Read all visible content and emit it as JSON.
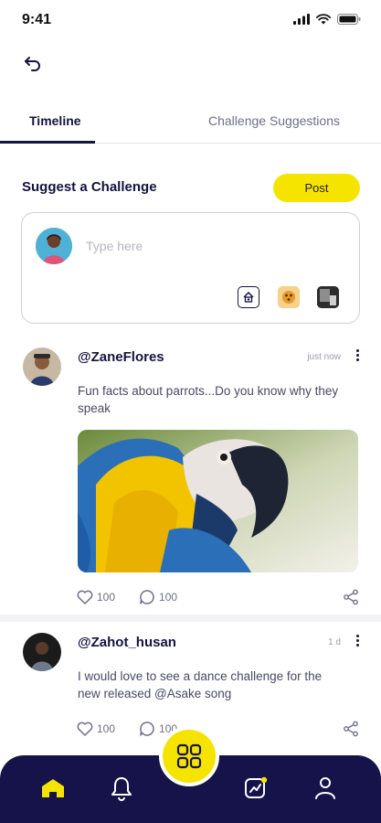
{
  "status": {
    "time": "9:41"
  },
  "tabs": [
    {
      "label": "Timeline",
      "active": true
    },
    {
      "label": "Challenge Suggestions",
      "active": false
    }
  ],
  "suggest": {
    "title": "Suggest a Challenge",
    "post_label": "Post",
    "placeholder": "Type here"
  },
  "posts": [
    {
      "user": "@ZaneFlores",
      "time": "just now",
      "text": "Fun facts about parrots...Do you know why they speak",
      "image": "parrot-photo",
      "likes": "100",
      "comments": "100"
    },
    {
      "user": "@Zahot_husan",
      "time": "1 d",
      "text": "I would love to see a dance challenge for the new released @Asake song",
      "likes": "100",
      "comments": "100"
    }
  ],
  "nav": {
    "items": [
      "home-icon",
      "bell-icon",
      "grid-icon",
      "chart-icon",
      "profile-icon"
    ]
  },
  "colors": {
    "accent": "#f5e400",
    "navy": "#15134a",
    "text": "#15133f",
    "muted": "#6f6e8a"
  }
}
